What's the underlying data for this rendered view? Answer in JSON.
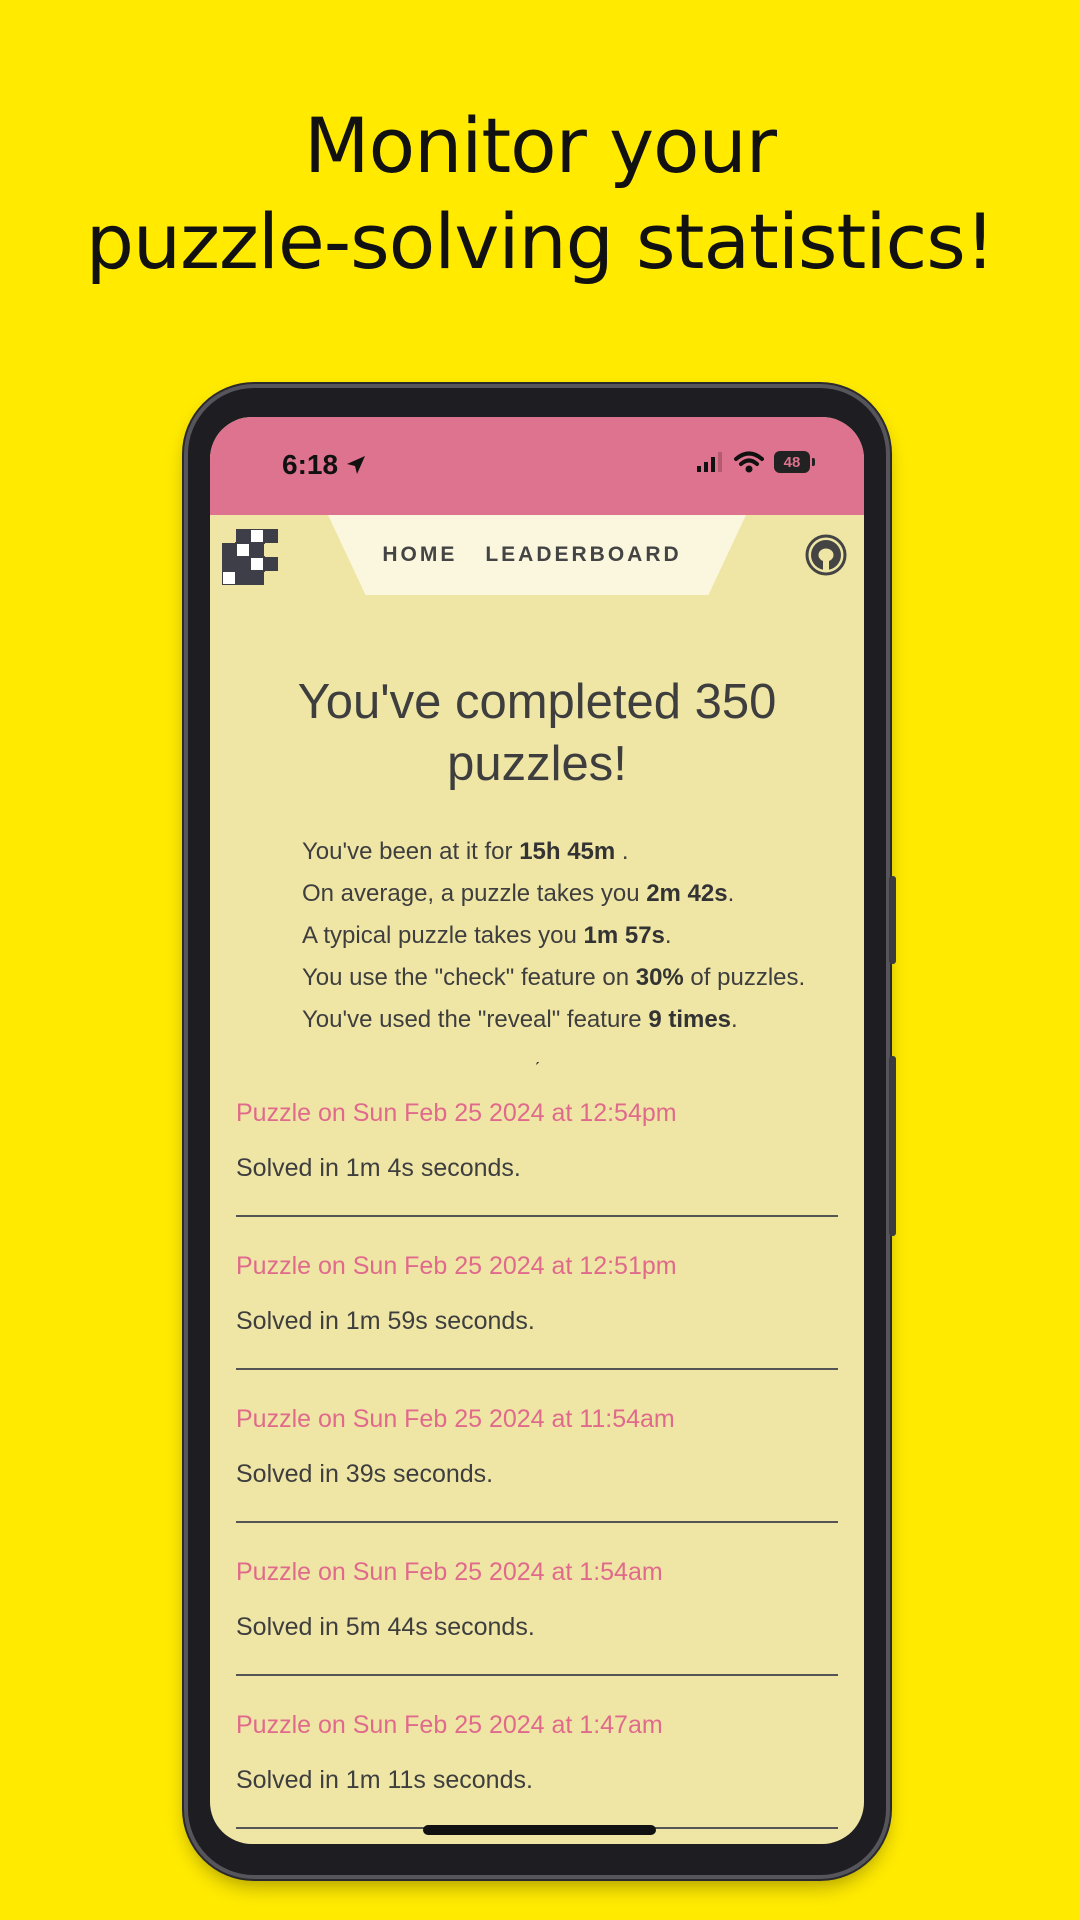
{
  "headline": {
    "line1": "Monitor your",
    "line2": "puzzle-solving statistics!"
  },
  "statusbar": {
    "time": "6:18",
    "battery": "48"
  },
  "nav": {
    "home": "HOME",
    "leaderboard": "LEADERBOARD"
  },
  "summary": {
    "title": "You've completed 350 puzzles!",
    "line1_pre": "You've been at it for ",
    "line1_val": "15h 45m",
    "line1_post": " .",
    "line2_pre": "On average, a puzzle takes you ",
    "line2_val": "2m 42s",
    "line2_post": ".",
    "line3_pre": "A typical puzzle takes you ",
    "line3_val": "1m 57s",
    "line3_post": ".",
    "line4_pre": "You use the \"check\" feature on ",
    "line4_val": "30%",
    "line4_post": " of puzzles.",
    "line5_pre": "You've used the \"reveal\" feature ",
    "line5_val": "9 times",
    "line5_post": "."
  },
  "entries": [
    {
      "title": "Puzzle on Sun Feb 25 2024 at 12:54pm",
      "solved": "Solved in 1m 4s seconds."
    },
    {
      "title": "Puzzle on Sun Feb 25 2024 at 12:51pm",
      "solved": "Solved in 1m 59s seconds."
    },
    {
      "title": "Puzzle on Sun Feb 25 2024 at 11:54am",
      "solved": "Solved in 39s seconds."
    },
    {
      "title": "Puzzle on Sun Feb 25 2024 at 1:54am",
      "solved": "Solved in 5m 44s seconds."
    },
    {
      "title": "Puzzle on Sun Feb 25 2024 at 1:47am",
      "solved": "Solved in 1m 11s seconds."
    }
  ],
  "colors": {
    "background": "#ffea00",
    "statusbar": "#dd738e",
    "app_bg": "#efe6a6",
    "link": "#e06a8c"
  }
}
